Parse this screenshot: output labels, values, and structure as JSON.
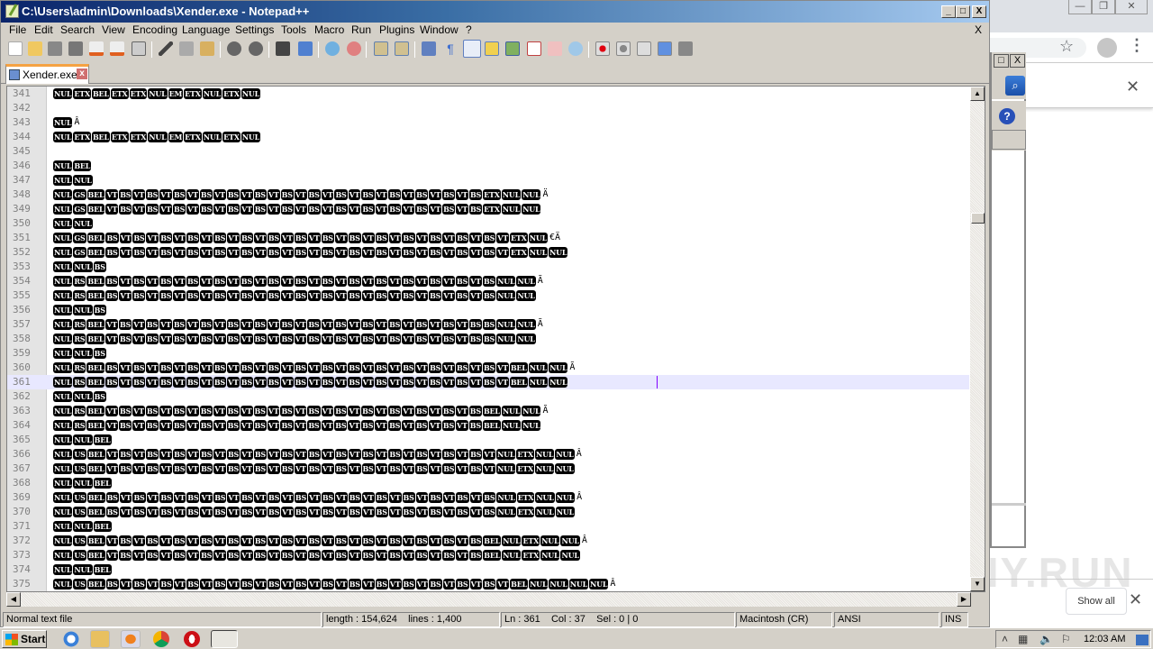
{
  "window": {
    "title": "C:\\Users\\admin\\Downloads\\Xender.exe - Notepad++",
    "minimize": "_",
    "maximize": "□",
    "close": "X"
  },
  "menu": {
    "items": [
      "File",
      "Edit",
      "Search",
      "View",
      "Encoding",
      "Language",
      "Settings",
      "Tools",
      "Macro",
      "Run",
      "Plugins",
      "Window",
      "?"
    ],
    "close_doc": "X"
  },
  "toolbar": {
    "icons": [
      "new-file-icon",
      "open-file-icon",
      "save-icon",
      "save-all-icon",
      "close-icon",
      "close-all-icon",
      "print-icon",
      "cut-icon",
      "copy-icon",
      "paste-icon",
      "undo-icon",
      "redo-icon",
      "find-icon",
      "replace-icon",
      "zoom-in-icon",
      "zoom-out-icon",
      "sync-vertical-icon",
      "sync-horizontal-icon",
      "word-wrap-icon",
      "show-all-chars-icon",
      "indent-guide-icon",
      "user-lang-icon",
      "doc-map-icon",
      "function-list-icon",
      "folder-workspace-icon",
      "monitoring-icon",
      "macro-record-icon",
      "macro-stop-icon",
      "macro-play-icon",
      "macro-run-multiple-icon",
      "macro-save-icon"
    ]
  },
  "tabs": [
    {
      "label": "Xender.exe",
      "close": "x",
      "active": true
    }
  ],
  "editor": {
    "current_line": 361,
    "lines": [
      {
        "n": "341",
        "tokens": [
          "NUL",
          "ETX",
          "BEL",
          "ETX",
          "ETX",
          "NUL",
          "EM",
          "ETX",
          "NUL",
          "ETX",
          "NUL"
        ],
        "tail": ""
      },
      {
        "n": "342",
        "tokens": [],
        "tail": ""
      },
      {
        "n": "343",
        "tokens": [
          "NUL"
        ],
        "tail": "Â"
      },
      {
        "n": "344",
        "tokens": [
          "NUL",
          "ETX",
          "BEL",
          "ETX",
          "ETX",
          "NUL",
          "EM",
          "ETX",
          "NUL",
          "ETX",
          "NUL"
        ],
        "tail": ""
      },
      {
        "n": "345",
        "tokens": [],
        "tail": ""
      },
      {
        "n": "346",
        "tokens": [
          "NUL",
          "BEL"
        ],
        "tail": ""
      },
      {
        "n": "347",
        "tokens": [
          "NUL",
          "NUL"
        ],
        "tail": ""
      },
      {
        "n": "348",
        "tokens": [
          "NUL",
          "GS",
          "BEL",
          "VT",
          "BS",
          "VT",
          "BS",
          "VT",
          "BS",
          "VT",
          "BS",
          "VT",
          "BS",
          "VT",
          "BS",
          "VT",
          "BS",
          "VT",
          "BS",
          "VT",
          "BS",
          "VT",
          "BS",
          "VT",
          "BS",
          "VT",
          "BS",
          "VT",
          "BS",
          "VT",
          "BS",
          "ETX",
          "NUL",
          "NUL"
        ],
        "tail": "Ä"
      },
      {
        "n": "349",
        "tokens": [
          "NUL",
          "GS",
          "BEL",
          "VT",
          "BS",
          "VT",
          "BS",
          "VT",
          "BS",
          "VT",
          "BS",
          "VT",
          "BS",
          "VT",
          "BS",
          "VT",
          "BS",
          "VT",
          "BS",
          "VT",
          "BS",
          "VT",
          "BS",
          "VT",
          "BS",
          "VT",
          "BS",
          "VT",
          "BS",
          "VT",
          "BS",
          "ETX",
          "NUL",
          "NUL"
        ],
        "tail": ""
      },
      {
        "n": "350",
        "tokens": [
          "NUL",
          "NUL"
        ],
        "tail": ""
      },
      {
        "n": "351",
        "tokens": [
          "NUL",
          "GS",
          "BEL",
          "BS",
          "VT",
          "BS",
          "VT",
          "BS",
          "VT",
          "BS",
          "VT",
          "BS",
          "VT",
          "BS",
          "VT",
          "BS",
          "VT",
          "BS",
          "VT",
          "BS",
          "VT",
          "BS",
          "VT",
          "BS",
          "VT",
          "BS",
          "VT",
          "BS",
          "VT",
          "BS",
          "VT",
          "BS",
          "VT",
          "ETX",
          "NUL"
        ],
        "tail": "€Ä"
      },
      {
        "n": "352",
        "tokens": [
          "NUL",
          "GS",
          "BEL",
          "BS",
          "VT",
          "BS",
          "VT",
          "BS",
          "VT",
          "BS",
          "VT",
          "BS",
          "VT",
          "BS",
          "VT",
          "BS",
          "VT",
          "BS",
          "VT",
          "BS",
          "VT",
          "BS",
          "VT",
          "BS",
          "VT",
          "BS",
          "VT",
          "BS",
          "VT",
          "BS",
          "VT",
          "BS",
          "VT",
          "ETX",
          "NUL",
          "NUL"
        ],
        "tail": ""
      },
      {
        "n": "353",
        "tokens": [
          "NUL",
          "NUL",
          "BS"
        ],
        "tail": ""
      },
      {
        "n": "354",
        "tokens": [
          "NUL",
          "RS",
          "BEL",
          "BS",
          "VT",
          "BS",
          "VT",
          "BS",
          "VT",
          "BS",
          "VT",
          "BS",
          "VT",
          "BS",
          "VT",
          "BS",
          "VT",
          "BS",
          "VT",
          "BS",
          "VT",
          "BS",
          "VT",
          "BS",
          "VT",
          "BS",
          "VT",
          "BS",
          "VT",
          "BS",
          "VT",
          "BS",
          "NUL",
          "NUL"
        ],
        "tail": "Ã"
      },
      {
        "n": "355",
        "tokens": [
          "NUL",
          "RS",
          "BEL",
          "BS",
          "VT",
          "BS",
          "VT",
          "BS",
          "VT",
          "BS",
          "VT",
          "BS",
          "VT",
          "BS",
          "VT",
          "BS",
          "VT",
          "BS",
          "VT",
          "BS",
          "VT",
          "BS",
          "VT",
          "BS",
          "VT",
          "BS",
          "VT",
          "BS",
          "VT",
          "BS",
          "VT",
          "BS",
          "NUL",
          "NUL"
        ],
        "tail": ""
      },
      {
        "n": "356",
        "tokens": [
          "NUL",
          "NUL",
          "BS"
        ],
        "tail": ""
      },
      {
        "n": "357",
        "tokens": [
          "NUL",
          "RS",
          "BEL",
          "VT",
          "BS",
          "VT",
          "BS",
          "VT",
          "BS",
          "VT",
          "BS",
          "VT",
          "BS",
          "VT",
          "BS",
          "VT",
          "BS",
          "VT",
          "BS",
          "VT",
          "BS",
          "VT",
          "BS",
          "VT",
          "BS",
          "VT",
          "BS",
          "VT",
          "BS",
          "VT",
          "BS",
          "BS",
          "NUL",
          "NUL"
        ],
        "tail": "Ã"
      },
      {
        "n": "358",
        "tokens": [
          "NUL",
          "RS",
          "BEL",
          "VT",
          "BS",
          "VT",
          "BS",
          "VT",
          "BS",
          "VT",
          "BS",
          "VT",
          "BS",
          "VT",
          "BS",
          "VT",
          "BS",
          "VT",
          "BS",
          "VT",
          "BS",
          "VT",
          "BS",
          "VT",
          "BS",
          "VT",
          "BS",
          "VT",
          "BS",
          "VT",
          "BS",
          "BS",
          "NUL",
          "NUL"
        ],
        "tail": ""
      },
      {
        "n": "359",
        "tokens": [
          "NUL",
          "NUL",
          "BS"
        ],
        "tail": ""
      },
      {
        "n": "360",
        "tokens": [
          "NUL",
          "RS",
          "BEL",
          "BS",
          "VT",
          "BS",
          "VT",
          "BS",
          "VT",
          "BS",
          "VT",
          "BS",
          "VT",
          "BS",
          "VT",
          "BS",
          "VT",
          "BS",
          "VT",
          "BS",
          "VT",
          "BS",
          "VT",
          "BS",
          "VT",
          "BS",
          "VT",
          "BS",
          "VT",
          "BS",
          "VT",
          "BS",
          "VT",
          "BEL",
          "NUL",
          "NUL"
        ],
        "tail": "Ã"
      },
      {
        "n": "361",
        "tokens": [
          "NUL",
          "RS",
          "BEL",
          "BS",
          "VT",
          "BS",
          "VT",
          "BS",
          "VT",
          "BS",
          "VT",
          "BS",
          "VT",
          "BS",
          "VT",
          "BS",
          "VT",
          "BS",
          "VT",
          "BS",
          "VT",
          "BS",
          "VT",
          "BS",
          "VT",
          "BS",
          "VT",
          "BS",
          "VT",
          "BS",
          "VT",
          "BS",
          "VT",
          "BEL",
          "NUL",
          "NUL"
        ],
        "tail": ""
      },
      {
        "n": "362",
        "tokens": [
          "NUL",
          "NUL",
          "BS"
        ],
        "tail": ""
      },
      {
        "n": "363",
        "tokens": [
          "NUL",
          "RS",
          "BEL",
          "VT",
          "BS",
          "VT",
          "BS",
          "VT",
          "BS",
          "VT",
          "BS",
          "VT",
          "BS",
          "VT",
          "BS",
          "VT",
          "BS",
          "VT",
          "BS",
          "VT",
          "BS",
          "VT",
          "BS",
          "VT",
          "BS",
          "VT",
          "BS",
          "VT",
          "BS",
          "VT",
          "BS",
          "BEL",
          "NUL",
          "NUL"
        ],
        "tail": "Ã"
      },
      {
        "n": "364",
        "tokens": [
          "NUL",
          "RS",
          "BEL",
          "VT",
          "BS",
          "VT",
          "BS",
          "VT",
          "BS",
          "VT",
          "BS",
          "VT",
          "BS",
          "VT",
          "BS",
          "VT",
          "BS",
          "VT",
          "BS",
          "VT",
          "BS",
          "VT",
          "BS",
          "VT",
          "BS",
          "VT",
          "BS",
          "VT",
          "BS",
          "VT",
          "BS",
          "BEL",
          "NUL",
          "NUL"
        ],
        "tail": ""
      },
      {
        "n": "365",
        "tokens": [
          "NUL",
          "NUL",
          "BEL"
        ],
        "tail": ""
      },
      {
        "n": "366",
        "tokens": [
          "NUL",
          "US",
          "BEL",
          "VT",
          "BS",
          "VT",
          "BS",
          "VT",
          "BS",
          "VT",
          "BS",
          "VT",
          "BS",
          "VT",
          "BS",
          "VT",
          "BS",
          "VT",
          "BS",
          "VT",
          "BS",
          "VT",
          "BS",
          "VT",
          "BS",
          "VT",
          "BS",
          "VT",
          "BS",
          "VT",
          "BS",
          "VT",
          "NUL",
          "ETX",
          "NUL",
          "NUL"
        ],
        "tail": "Â"
      },
      {
        "n": "367",
        "tokens": [
          "NUL",
          "US",
          "BEL",
          "VT",
          "BS",
          "VT",
          "BS",
          "VT",
          "BS",
          "VT",
          "BS",
          "VT",
          "BS",
          "VT",
          "BS",
          "VT",
          "BS",
          "VT",
          "BS",
          "VT",
          "BS",
          "VT",
          "BS",
          "VT",
          "BS",
          "VT",
          "BS",
          "VT",
          "BS",
          "VT",
          "BS",
          "VT",
          "NUL",
          "ETX",
          "NUL",
          "NUL"
        ],
        "tail": ""
      },
      {
        "n": "368",
        "tokens": [
          "NUL",
          "NUL",
          "BEL"
        ],
        "tail": ""
      },
      {
        "n": "369",
        "tokens": [
          "NUL",
          "US",
          "BEL",
          "BS",
          "VT",
          "BS",
          "VT",
          "BS",
          "VT",
          "BS",
          "VT",
          "BS",
          "VT",
          "BS",
          "VT",
          "BS",
          "VT",
          "BS",
          "VT",
          "BS",
          "VT",
          "BS",
          "VT",
          "BS",
          "VT",
          "BS",
          "VT",
          "BS",
          "VT",
          "BS",
          "VT",
          "BS",
          "NUL",
          "ETX",
          "NUL",
          "NUL"
        ],
        "tail": "Â"
      },
      {
        "n": "370",
        "tokens": [
          "NUL",
          "US",
          "BEL",
          "BS",
          "VT",
          "BS",
          "VT",
          "BS",
          "VT",
          "BS",
          "VT",
          "BS",
          "VT",
          "BS",
          "VT",
          "BS",
          "VT",
          "BS",
          "VT",
          "BS",
          "VT",
          "BS",
          "VT",
          "BS",
          "VT",
          "BS",
          "VT",
          "BS",
          "VT",
          "BS",
          "VT",
          "BS",
          "NUL",
          "ETX",
          "NUL",
          "NUL"
        ],
        "tail": ""
      },
      {
        "n": "371",
        "tokens": [
          "NUL",
          "NUL",
          "BEL"
        ],
        "tail": ""
      },
      {
        "n": "372",
        "tokens": [
          "NUL",
          "US",
          "BEL",
          "VT",
          "BS",
          "VT",
          "BS",
          "VT",
          "BS",
          "VT",
          "BS",
          "VT",
          "BS",
          "VT",
          "BS",
          "VT",
          "BS",
          "VT",
          "BS",
          "VT",
          "BS",
          "VT",
          "BS",
          "VT",
          "BS",
          "VT",
          "BS",
          "VT",
          "BS",
          "VT",
          "BS",
          "BEL",
          "NUL",
          "ETX",
          "NUL",
          "NUL"
        ],
        "tail": "Â"
      },
      {
        "n": "373",
        "tokens": [
          "NUL",
          "US",
          "BEL",
          "VT",
          "BS",
          "VT",
          "BS",
          "VT",
          "BS",
          "VT",
          "BS",
          "VT",
          "BS",
          "VT",
          "BS",
          "VT",
          "BS",
          "VT",
          "BS",
          "VT",
          "BS",
          "VT",
          "BS",
          "VT",
          "BS",
          "VT",
          "BS",
          "VT",
          "BS",
          "VT",
          "BS",
          "BEL",
          "NUL",
          "ETX",
          "NUL",
          "NUL"
        ],
        "tail": ""
      },
      {
        "n": "374",
        "tokens": [
          "NUL",
          "NUL",
          "BEL"
        ],
        "tail": ""
      },
      {
        "n": "375",
        "tokens": [
          "NUL",
          "US",
          "BEL",
          "BS",
          "VT",
          "BS",
          "VT",
          "BS",
          "VT",
          "BS",
          "VT",
          "BS",
          "VT",
          "BS",
          "VT",
          "BS",
          "VT",
          "BS",
          "VT",
          "BS",
          "VT",
          "BS",
          "VT",
          "BS",
          "VT",
          "BS",
          "VT",
          "BS",
          "VT",
          "BS",
          "VT",
          "BS",
          "VT",
          "BEL",
          "NUL",
          "NUL",
          "NUL",
          "NUL"
        ],
        "tail": "Â"
      }
    ],
    "vertical_scroll_position": 0.24
  },
  "statusbar": {
    "file_type": "Normal text file",
    "length_lines": "length : 154,624    lines : 1,400",
    "position": "Ln : 361    Col : 37    Sel : 0 | 0",
    "eol": "Macintosh (CR)",
    "encoding": "ANSI",
    "mode": "INS"
  },
  "chrome": {
    "show_all": "Show all",
    "close": "✕",
    "star": "☆",
    "menu": "⋮",
    "win_minimize": "—",
    "win_restore": "❐",
    "win_close": "✕"
  },
  "side_panel": {
    "maximize": "□",
    "close": "X",
    "search": "⌕",
    "help": "?"
  },
  "taskbar": {
    "start_label": "Start",
    "quick_launch": [
      "internet-explorer-icon",
      "file-explorer-icon",
      "media-player-icon",
      "chrome-icon",
      "opera-icon",
      "notepadpp-icon"
    ],
    "clock": "12:03 AM",
    "tray": {
      "expand": "˄"
    }
  },
  "watermark": "ANY.RUN"
}
